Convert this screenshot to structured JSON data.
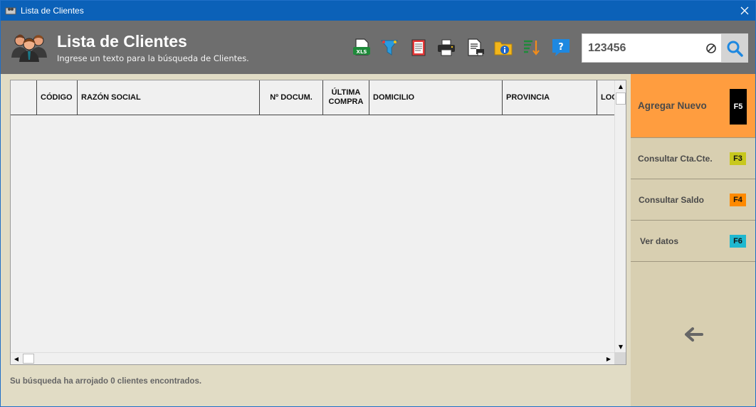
{
  "window": {
    "title": "Lista de Clientes",
    "close_symbol": "✕"
  },
  "header": {
    "title": "Lista de Clientes",
    "subtitle": "Ingrese un texto para la búsqueda de Clientes.",
    "toolbar_icons": [
      "excel-export-icon",
      "filter-icon",
      "report-icon",
      "printer-icon",
      "print-preview-icon",
      "folder-info-icon",
      "sort-icon",
      "help-icon"
    ],
    "excel_label": "XLS",
    "help_label": "?"
  },
  "search": {
    "value": "123456",
    "placeholder": ""
  },
  "grid": {
    "columns": [
      "",
      "CÓDIGO",
      "RAZÓN SOCIAL",
      "Nº DOCUM.",
      "ÚLTIMA COMPRA",
      "DOMICILIO",
      "PROVINCIA",
      "LOC"
    ],
    "rows": []
  },
  "status": {
    "text": "Su búsqueda ha arrojado 0 clientes encontrados."
  },
  "side": {
    "buttons": [
      {
        "label": "Agregar Nuevo",
        "key": "F5",
        "key_color": "#000000"
      },
      {
        "label": "Consultar Cta.Cte.",
        "key": "F3",
        "key_color": "#c8c81e"
      },
      {
        "label": "Consultar Saldo",
        "key": "F4",
        "key_color": "#ff8a00"
      },
      {
        "label": "Ver datos",
        "key": "F6",
        "key_color": "#1fb8d0"
      }
    ]
  },
  "colors": {
    "titlebar": "#0b61b8",
    "header": "#6e6e6e",
    "primary_button": "#ff9d3f",
    "side_panel": "#d8cfb1",
    "background": "#e1dcc5"
  }
}
